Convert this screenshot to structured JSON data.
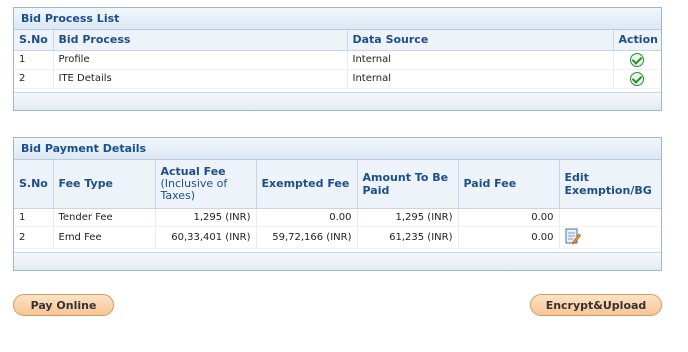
{
  "bid_process": {
    "title": "Bid Process List",
    "headers": {
      "sno": "S.No",
      "process": "Bid Process",
      "source": "Data Source",
      "action": "Action"
    },
    "rows": [
      {
        "sno": "1",
        "process": "Profile",
        "source": "Internal",
        "action_icon": "check-circle-icon"
      },
      {
        "sno": "2",
        "process": "ITE Details",
        "source": "Internal",
        "action_icon": "check-circle-icon"
      }
    ]
  },
  "bid_payment": {
    "title": "Bid Payment Details",
    "headers": {
      "sno": "S.No",
      "fee_type": "Fee Type",
      "actual_fee_1": "Actual Fee",
      "actual_fee_2": "(Inclusive of",
      "actual_fee_3": "Taxes)",
      "exempted": "Exempted Fee",
      "amount_1": "Amount To Be",
      "amount_2": "Paid",
      "paid": "Paid Fee",
      "edit_1": "Edit",
      "edit_2": "Exemption/BG"
    },
    "rows": [
      {
        "sno": "1",
        "fee_type": "Tender Fee",
        "actual": "1,295 (INR)",
        "exempted": "0.00",
        "amount": "1,295 (INR)",
        "paid": "0.00",
        "edit_icon": ""
      },
      {
        "sno": "2",
        "fee_type": "Emd Fee",
        "actual": "60,33,401 (INR)",
        "exempted": "59,72,166 (INR)",
        "amount": "61,235 (INR)",
        "paid": "0.00",
        "edit_icon": "edit-document-icon"
      }
    ]
  },
  "buttons": {
    "pay_online": "Pay Online",
    "encrypt_upload": "Encrypt&Upload"
  },
  "colors": {
    "header_text": "#1a4f8c",
    "panel_border": "#9fb6d0",
    "button_fill": "#f7c594",
    "button_border": "#d79a5c",
    "check_green": "#2f8a2f"
  }
}
